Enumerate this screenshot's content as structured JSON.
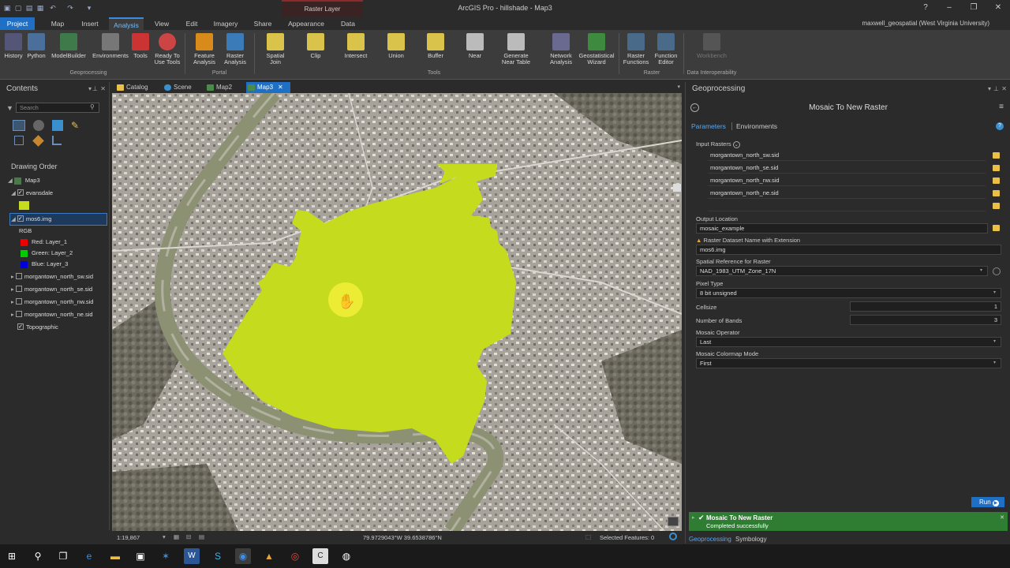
{
  "app": {
    "title": "ArcGIS Pro - hillshade - Map3",
    "context_tab": "Raster Layer",
    "user": "maxwell_geospatial (West Virginia University)"
  },
  "menu_tabs": [
    "Project",
    "Map",
    "Insert",
    "Analysis",
    "View",
    "Edit",
    "Imagery",
    "Share",
    "Appearance",
    "Data"
  ],
  "ribbon": {
    "buttons": [
      {
        "label": "History"
      },
      {
        "label": "Python"
      },
      {
        "label": "ModelBuilder"
      },
      {
        "label": "Environments"
      },
      {
        "label": "Tools"
      },
      {
        "label": "Ready To Use Tools"
      },
      {
        "label": "Feature Analysis"
      },
      {
        "label": "Raster Analysis"
      },
      {
        "label": "Spatial Join"
      },
      {
        "label": "Clip"
      },
      {
        "label": "Intersect"
      },
      {
        "label": "Union"
      },
      {
        "label": "Buffer"
      },
      {
        "label": "Near"
      },
      {
        "label": "Generate Near Table"
      },
      {
        "label": "Network Analysis"
      },
      {
        "label": "Geostatistical Wizard"
      },
      {
        "label": "Raster Functions"
      },
      {
        "label": "Function Editor"
      },
      {
        "label": "Workbench"
      }
    ],
    "groups": [
      "Geoprocessing",
      "Portal",
      "Tools",
      "Raster",
      "Data Interoperability"
    ]
  },
  "contents": {
    "title": "Contents",
    "search_placeholder": "Search",
    "drawing_order": "Drawing Order",
    "map_name": "Map3",
    "layers": {
      "evansdale": "evansdale",
      "mos6": "mos6.img",
      "rgb": "RGB",
      "red": "Red:   Layer_1",
      "green": "Green: Layer_2",
      "blue": "Blue:  Layer_3",
      "sw": "morgantown_north_sw.sid",
      "se": "morgantown_north_se.sid",
      "nw": "morgantown_north_nw.sid",
      "ne": "morgantown_north_ne.sid",
      "topo": "Topographic"
    }
  },
  "view_tabs": [
    "Catalog",
    "Scene",
    "Map2",
    "Map3"
  ],
  "status": {
    "scale": "1:19,867",
    "coords": "79.9729043°W 39.6538786°N",
    "selected": "Selected Features: 0"
  },
  "gp": {
    "title": "Geoprocessing",
    "tool": "Mosaic To New Raster",
    "tab_params": "Parameters",
    "tab_env": "Environments",
    "input_rasters_label": "Input Rasters",
    "inputs": [
      "morgantown_north_sw.sid",
      "morgantown_north_se.sid",
      "morgantown_north_nw.sid",
      "morgantown_north_ne.sid"
    ],
    "output_location_label": "Output Location",
    "output_location": "mosaic_example",
    "dataset_name_label": "Raster Dataset Name with Extension",
    "dataset_name": "mos6.img",
    "spatial_ref_label": "Spatial Reference for Raster",
    "spatial_ref": "NAD_1983_UTM_Zone_17N",
    "pixel_type_label": "Pixel Type",
    "pixel_type": "8 bit unsigned",
    "cellsize_label": "Cellsize",
    "cellsize": "1",
    "bands_label": "Number of Bands",
    "bands": "3",
    "mosaic_op_label": "Mosaic Operator",
    "mosaic_op": "Last",
    "colormap_label": "Mosaic Colormap Mode",
    "colormap": "First",
    "run": "Run",
    "msg_title": "Mosaic To New Raster",
    "msg_status": "Completed successfully",
    "bottom_tab1": "Geoprocessing",
    "bottom_tab2": "Symbology"
  },
  "colors": {
    "accent": "#1f6fc5",
    "polygon": "#c5dc1e",
    "success": "#2e7d32"
  }
}
